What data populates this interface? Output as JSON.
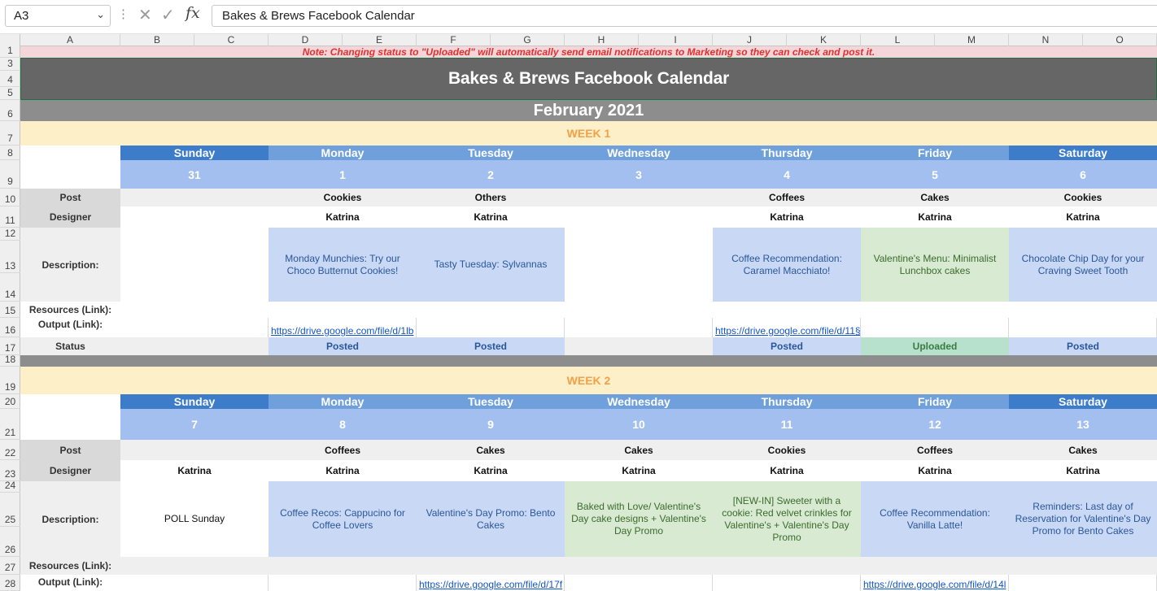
{
  "formula_bar": {
    "name_box": "A3",
    "formula": "Bakes & Brews Facebook Calendar"
  },
  "columns": [
    "A",
    "B",
    "C",
    "D",
    "E",
    "F",
    "G",
    "H",
    "I",
    "J",
    "K",
    "L",
    "M",
    "N",
    "O"
  ],
  "rows": [
    "1",
    "3",
    "4",
    "5",
    "6",
    "7",
    "8",
    "9",
    "10",
    "11",
    "12",
    "13",
    "14",
    "15",
    "16",
    "17",
    "18",
    "19",
    "20",
    "21",
    "22",
    "23",
    "24",
    "25",
    "26",
    "27",
    "28"
  ],
  "note": "Note: Changing status to \"Uploaded\" will automatically send email notifications to Marketing so they can check and post it.",
  "title": "Bakes & Brews Facebook Calendar",
  "month": "February 2021",
  "labels": {
    "post": "Post",
    "designer": "Designer",
    "description": "Description:",
    "resources": "Resources (Link):",
    "output": "Output (Link):",
    "status": "Status"
  },
  "day_names": [
    "Sunday",
    "Monday",
    "Tuesday",
    "Wednesday",
    "Thursday",
    "Friday",
    "Saturday"
  ],
  "colors": {
    "sunday_header": "#3d7cc9",
    "weekday_header": "#6fa0dc",
    "saturday_header": "#3d7cc9"
  },
  "weeks": [
    {
      "label": "WEEK 1",
      "dates": [
        "31",
        "1",
        "2",
        "3",
        "4",
        "5",
        "6"
      ],
      "post": [
        "",
        "Cookies",
        "Others",
        "",
        "Coffees",
        "Cakes",
        "Cookies"
      ],
      "designer": [
        "",
        "Katrina",
        "Katrina",
        "",
        "Katrina",
        "Katrina",
        "Katrina"
      ],
      "description": [
        "",
        "Monday Munchies: Try our Choco Butternut Cookies!",
        "Tasty Tuesday: Sylvannas",
        "",
        "Coffee Recommendation: Caramel Macchiato!",
        "Valentine's Menu: Minimalist Lunchbox cakes",
        "Chocolate Chip Day for your Craving Sweet Tooth"
      ],
      "output": [
        "",
        "https://drive.google.com/file/d/1lb",
        "",
        "",
        "https://drive.google.com/file/d/11§",
        "",
        ""
      ],
      "status": [
        "",
        "Posted",
        "Posted",
        "",
        "Posted",
        "Uploaded",
        "Posted"
      ]
    },
    {
      "label": "WEEK 2",
      "dates": [
        "7",
        "8",
        "9",
        "10",
        "11",
        "12",
        "13"
      ],
      "post": [
        "",
        "Coffees",
        "Cakes",
        "Cakes",
        "Cookies",
        "Coffees",
        "Cakes"
      ],
      "designer": [
        "Katrina",
        "Katrina",
        "Katrina",
        "Katrina",
        "Katrina",
        "Katrina",
        "Katrina"
      ],
      "description": [
        "POLL Sunday",
        "Coffee Recos: Cappucino for Coffee Lovers",
        "Valentine's Day Promo: Bento Cakes",
        "Baked with Love/ Valentine's Day cake designs + Valentine's Day Promo",
        "[NEW-IN] Sweeter with a cookie: Red velvet crinkles for Valentine's + Valentine's Day Promo",
        "Coffee Recommendation: Vanilla Latte!",
        "Reminders: Last day of Reservation for Valentine's Day Promo for Bento Cakes"
      ],
      "output": [
        "",
        "",
        "https://drive.google.com/file/d/17f",
        "",
        "",
        "https://drive.google.com/file/d/14l",
        ""
      ]
    }
  ]
}
